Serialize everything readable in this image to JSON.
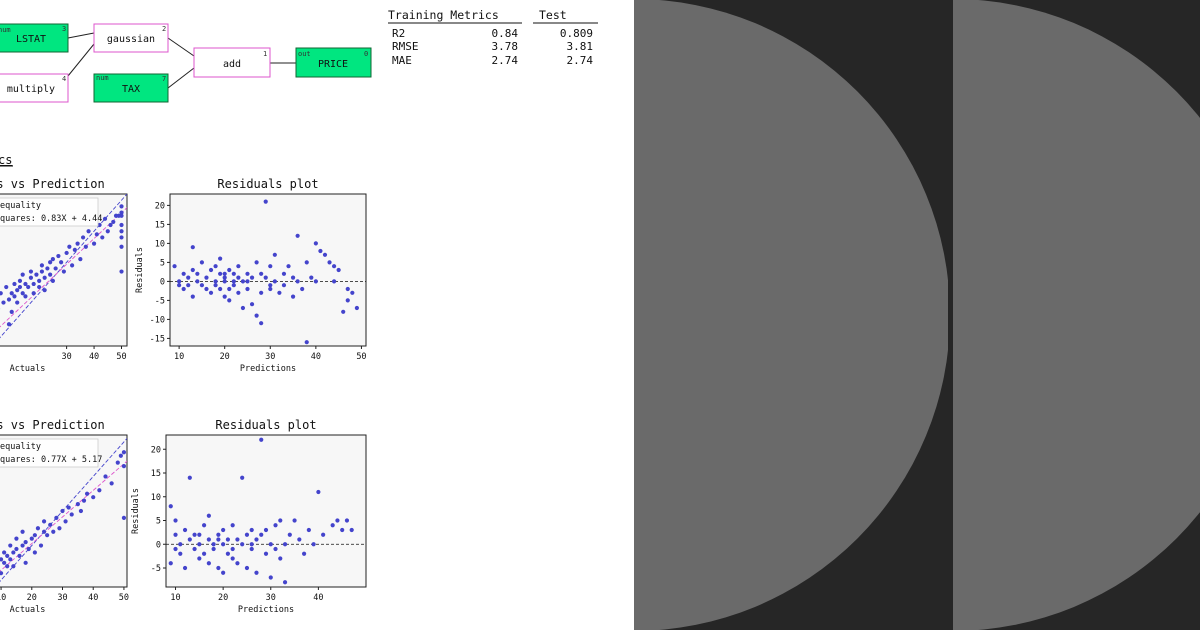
{
  "graph": {
    "nodes": [
      {
        "id": "lstat",
        "kind": "num",
        "label": "LSTAT",
        "index": "3",
        "style": "leaf"
      },
      {
        "id": "multiply",
        "kind": "",
        "label": "multiply",
        "index": "4",
        "style": "op"
      },
      {
        "id": "gaussian",
        "kind": "",
        "label": "gaussian",
        "index": "2",
        "style": "op"
      },
      {
        "id": "tax",
        "kind": "num",
        "label": "TAX",
        "index": "7",
        "style": "leaf"
      },
      {
        "id": "add",
        "kind": "",
        "label": "add",
        "index": "1",
        "style": "op"
      },
      {
        "id": "price",
        "kind": "out",
        "label": "PRICE",
        "index": "0",
        "style": "leaf"
      }
    ]
  },
  "metrics": {
    "header_train": "Training Metrics",
    "header_test": "Test",
    "rows": [
      {
        "name": "R2",
        "train": "0.84",
        "test": "0.809"
      },
      {
        "name": "RMSE",
        "train": "3.78",
        "test": "3.81"
      },
      {
        "name": "MAE",
        "train": "2.74",
        "test": "2.74"
      }
    ]
  },
  "section_heading": "cs",
  "colors": {
    "points": "#4444cc",
    "leaf_fill": "#00e680",
    "op_border": "#dd55cc",
    "fit_line": "#dd55cc",
    "equality_line": "#4444cc",
    "right_panel": "#262626",
    "circle": "#6a6a6a"
  },
  "chart_data": [
    {
      "type": "scatter",
      "title": "s vs Prediction",
      "xlabel": "Actuals",
      "ylabel": "",
      "xlim": [
        5,
        52
      ],
      "ylim": [
        3,
        52
      ],
      "xticks": [
        30,
        40,
        50
      ],
      "legend": [
        "equality",
        "quares: 0.83X + 4.44"
      ],
      "fit": {
        "slope": 0.83,
        "intercept": 4.44
      },
      "points": [
        [
          5,
          15
        ],
        [
          6,
          20
        ],
        [
          7,
          17
        ],
        [
          8,
          22
        ],
        [
          9,
          10
        ],
        [
          9,
          18
        ],
        [
          10,
          20
        ],
        [
          10,
          14
        ],
        [
          11,
          23
        ],
        [
          11,
          19
        ],
        [
          12,
          17
        ],
        [
          12,
          21
        ],
        [
          13,
          24
        ],
        [
          13,
          22
        ],
        [
          14,
          20
        ],
        [
          14,
          26
        ],
        [
          15,
          23
        ],
        [
          15,
          19
        ],
        [
          16,
          22
        ],
        [
          17,
          25
        ],
        [
          17,
          27
        ],
        [
          18,
          23
        ],
        [
          18,
          20
        ],
        [
          19,
          26
        ],
        [
          20,
          24
        ],
        [
          20,
          22
        ],
        [
          21,
          27
        ],
        [
          21,
          29
        ],
        [
          22,
          25
        ],
        [
          22,
          21
        ],
        [
          23,
          28
        ],
        [
          24,
          30
        ],
        [
          24,
          26
        ],
        [
          25,
          24
        ],
        [
          25,
          31
        ],
        [
          26,
          28
        ],
        [
          27,
          32
        ],
        [
          28,
          30
        ],
        [
          29,
          27
        ],
        [
          30,
          33
        ],
        [
          31,
          35
        ],
        [
          32,
          29
        ],
        [
          33,
          34
        ],
        [
          34,
          36
        ],
        [
          35,
          31
        ],
        [
          36,
          38
        ],
        [
          37,
          35
        ],
        [
          38,
          40
        ],
        [
          40,
          36
        ],
        [
          41,
          39
        ],
        [
          42,
          42
        ],
        [
          43,
          38
        ],
        [
          44,
          44
        ],
        [
          45,
          40
        ],
        [
          46,
          42
        ],
        [
          47,
          43
        ],
        [
          48,
          45
        ],
        [
          49,
          45
        ],
        [
          50,
          48
        ],
        [
          50,
          42
        ],
        [
          50,
          38
        ],
        [
          50,
          35
        ],
        [
          50,
          27
        ],
        [
          50,
          45
        ],
        [
          50,
          46
        ],
        [
          50,
          40
        ]
      ]
    },
    {
      "type": "scatter",
      "title": "Residuals plot",
      "xlabel": "Predictions",
      "ylabel": "Residuals",
      "xlim": [
        8,
        51
      ],
      "ylim": [
        -17,
        23
      ],
      "xticks": [
        10,
        20,
        30,
        40,
        50
      ],
      "yticks": [
        -15,
        -10,
        -5,
        0,
        5,
        10,
        15,
        20
      ],
      "zero_line": true,
      "points": [
        [
          9,
          4
        ],
        [
          10,
          0
        ],
        [
          10,
          -1
        ],
        [
          11,
          2
        ],
        [
          11,
          -2
        ],
        [
          12,
          1
        ],
        [
          12,
          -1
        ],
        [
          13,
          3
        ],
        [
          13,
          9
        ],
        [
          13,
          -4
        ],
        [
          14,
          2
        ],
        [
          14,
          0
        ],
        [
          15,
          -1
        ],
        [
          15,
          5
        ],
        [
          16,
          1
        ],
        [
          16,
          -2
        ],
        [
          17,
          3
        ],
        [
          17,
          -3
        ],
        [
          18,
          0
        ],
        [
          18,
          4
        ],
        [
          18,
          -1
        ],
        [
          19,
          2
        ],
        [
          19,
          -2
        ],
        [
          19,
          6
        ],
        [
          20,
          1
        ],
        [
          20,
          -4
        ],
        [
          20,
          0
        ],
        [
          21,
          3
        ],
        [
          21,
          -2
        ],
        [
          21,
          -5
        ],
        [
          22,
          2
        ],
        [
          22,
          0
        ],
        [
          22,
          -1
        ],
        [
          23,
          4
        ],
        [
          23,
          -3
        ],
        [
          23,
          1
        ],
        [
          24,
          -7
        ],
        [
          24,
          0
        ],
        [
          25,
          2
        ],
        [
          25,
          -2
        ],
        [
          26,
          -6
        ],
        [
          26,
          1
        ],
        [
          27,
          5
        ],
        [
          27,
          -9
        ],
        [
          28,
          2
        ],
        [
          28,
          -3
        ],
        [
          28,
          -11
        ],
        [
          29,
          1
        ],
        [
          29,
          21
        ],
        [
          30,
          -2
        ],
        [
          30,
          4
        ],
        [
          31,
          0
        ],
        [
          31,
          7
        ],
        [
          32,
          -3
        ],
        [
          33,
          2
        ],
        [
          33,
          -1
        ],
        [
          34,
          4
        ],
        [
          35,
          -4
        ],
        [
          36,
          12
        ],
        [
          36,
          0
        ],
        [
          37,
          -2
        ],
        [
          38,
          5
        ],
        [
          38,
          -16
        ],
        [
          39,
          1
        ],
        [
          40,
          10
        ],
        [
          41,
          8
        ],
        [
          42,
          7
        ],
        [
          43,
          5
        ],
        [
          44,
          4
        ],
        [
          45,
          3
        ],
        [
          46,
          -8
        ],
        [
          47,
          -2
        ],
        [
          47,
          -5
        ],
        [
          48,
          -3
        ],
        [
          49,
          -7
        ],
        [
          44,
          0
        ],
        [
          40,
          0
        ],
        [
          35,
          1
        ],
        [
          30,
          -1
        ],
        [
          25,
          0
        ],
        [
          20,
          2
        ]
      ]
    },
    {
      "type": "scatter",
      "title": "s vs Prediction",
      "xlabel": "Actuals",
      "ylabel": "",
      "xlim": [
        9,
        51
      ],
      "ylim": [
        8,
        52
      ],
      "xticks": [
        10,
        20,
        30,
        40,
        50
      ],
      "legend": [
        "equality",
        "quares: 0.77X + 5.17"
      ],
      "fit": {
        "slope": 0.77,
        "intercept": 5.17
      },
      "points": [
        [
          9,
          13
        ],
        [
          10,
          16
        ],
        [
          10,
          12
        ],
        [
          11,
          15
        ],
        [
          11,
          18
        ],
        [
          12,
          14
        ],
        [
          12,
          17
        ],
        [
          13,
          20
        ],
        [
          13,
          16
        ],
        [
          14,
          18
        ],
        [
          14,
          14
        ],
        [
          15,
          19
        ],
        [
          15,
          22
        ],
        [
          16,
          17
        ],
        [
          17,
          20
        ],
        [
          17,
          24
        ],
        [
          18,
          21
        ],
        [
          18,
          15
        ],
        [
          19,
          19
        ],
        [
          20,
          22
        ],
        [
          21,
          23
        ],
        [
          21,
          18
        ],
        [
          22,
          25
        ],
        [
          23,
          20
        ],
        [
          24,
          24
        ],
        [
          24,
          27
        ],
        [
          25,
          23
        ],
        [
          26,
          26
        ],
        [
          27,
          24
        ],
        [
          28,
          28
        ],
        [
          29,
          25
        ],
        [
          30,
          30
        ],
        [
          31,
          27
        ],
        [
          32,
          31
        ],
        [
          33,
          29
        ],
        [
          35,
          32
        ],
        [
          36,
          30
        ],
        [
          37,
          33
        ],
        [
          38,
          35
        ],
        [
          40,
          34
        ],
        [
          42,
          36
        ],
        [
          44,
          40
        ],
        [
          46,
          38
        ],
        [
          48,
          44
        ],
        [
          49,
          46
        ],
        [
          50,
          47
        ],
        [
          50,
          28
        ],
        [
          50,
          43
        ]
      ]
    },
    {
      "type": "scatter",
      "title": "Residuals plot",
      "xlabel": "Predictions",
      "ylabel": "Residuals",
      "xlim": [
        8,
        50
      ],
      "ylim": [
        -9,
        23
      ],
      "xticks": [
        10,
        20,
        30,
        40
      ],
      "yticks": [
        -5,
        0,
        5,
        10,
        15,
        20
      ],
      "zero_line": true,
      "points": [
        [
          9,
          8
        ],
        [
          9,
          -4
        ],
        [
          10,
          2
        ],
        [
          10,
          -1
        ],
        [
          10,
          5
        ],
        [
          11,
          0
        ],
        [
          11,
          -2
        ],
        [
          12,
          3
        ],
        [
          12,
          -5
        ],
        [
          13,
          1
        ],
        [
          13,
          14
        ],
        [
          14,
          -1
        ],
        [
          14,
          2
        ],
        [
          15,
          0
        ],
        [
          15,
          -3
        ],
        [
          16,
          4
        ],
        [
          16,
          -2
        ],
        [
          17,
          1
        ],
        [
          17,
          6
        ],
        [
          17,
          -4
        ],
        [
          18,
          0
        ],
        [
          18,
          -1
        ],
        [
          19,
          2
        ],
        [
          19,
          -5
        ],
        [
          20,
          0
        ],
        [
          20,
          3
        ],
        [
          20,
          -6
        ],
        [
          21,
          1
        ],
        [
          21,
          -2
        ],
        [
          22,
          4
        ],
        [
          22,
          -3
        ],
        [
          23,
          1
        ],
        [
          23,
          -4
        ],
        [
          24,
          14
        ],
        [
          24,
          0
        ],
        [
          25,
          2
        ],
        [
          25,
          -5
        ],
        [
          26,
          -1
        ],
        [
          26,
          3
        ],
        [
          27,
          1
        ],
        [
          27,
          -6
        ],
        [
          28,
          2
        ],
        [
          28,
          22
        ],
        [
          29,
          -2
        ],
        [
          29,
          3
        ],
        [
          30,
          0
        ],
        [
          30,
          -7
        ],
        [
          31,
          4
        ],
        [
          31,
          -1
        ],
        [
          32,
          5
        ],
        [
          32,
          -3
        ],
        [
          33,
          0
        ],
        [
          33,
          -8
        ],
        [
          34,
          2
        ],
        [
          35,
          5
        ],
        [
          36,
          1
        ],
        [
          37,
          -2
        ],
        [
          38,
          3
        ],
        [
          39,
          0
        ],
        [
          40,
          11
        ],
        [
          41,
          2
        ],
        [
          43,
          4
        ],
        [
          44,
          5
        ],
        [
          45,
          3
        ],
        [
          46,
          5
        ],
        [
          47,
          3
        ],
        [
          22,
          -1
        ],
        [
          26,
          0
        ],
        [
          19,
          1
        ],
        [
          15,
          2
        ]
      ]
    }
  ]
}
